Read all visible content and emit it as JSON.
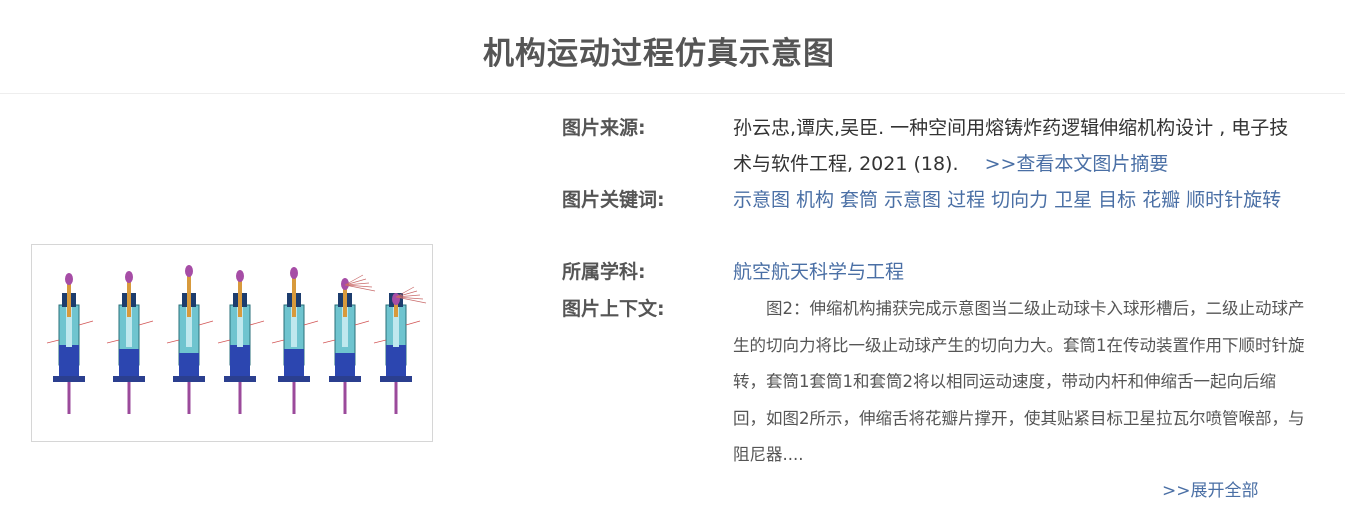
{
  "page": {
    "title": "机构运动过程仿真示意图"
  },
  "info": {
    "source": {
      "label": "图片来源:",
      "text": "孙云忠,谭庆,吴臣. 一种空间用熔铸炸药逻辑伸缩机构设计 , 电子技术与软件工程, 2021 (18).",
      "link_label": ">>查看本文图片摘要"
    },
    "keywords": {
      "label": "图片关键词:",
      "items": [
        "示意图",
        "机构",
        "套筒",
        "示意图",
        "过程",
        "切向力",
        "卫星",
        "目标",
        "花瓣",
        "顺时针旋转"
      ]
    },
    "subject": {
      "label": "所属学科:",
      "value": "航空航天科学与工程"
    },
    "context": {
      "label": "图片上下文:",
      "text": "图2：伸缩机构捕获完成示意图当二级止动球卡入球形槽后，二级止动球产生的切向力将比一级止动球产生的切向力大。套筒1在传动装置作用下顺时针旋转，套筒1套筒1和套筒2将以相同运动速度，带动内杆和伸缩舌一起向后缩回，如图2所示，伸缩舌将花瓣片撑开，使其贴紧目标卫星拉瓦尔喷管喉部，与阻尼器...."
    },
    "expand_label": ">>展开全部"
  },
  "colors": {
    "label": "#555555",
    "link": "#4a6fa5",
    "body_text": "#333333"
  }
}
